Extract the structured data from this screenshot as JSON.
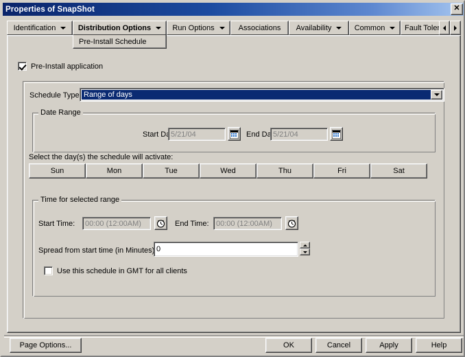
{
  "window": {
    "title": "Properties of SnapShot",
    "close_label": "✕"
  },
  "tabs": [
    {
      "label": "Identification",
      "has_arrow": true,
      "active": false
    },
    {
      "label": "Distribution Options",
      "has_arrow": true,
      "active": true
    },
    {
      "label": "Run Options",
      "has_arrow": true,
      "active": false
    },
    {
      "label": "Associations",
      "has_arrow": false,
      "active": false
    },
    {
      "label": "Availability",
      "has_arrow": true,
      "active": false
    },
    {
      "label": "Common",
      "has_arrow": true,
      "active": false
    },
    {
      "label": "Fault Toleran",
      "has_arrow": false,
      "active": false
    }
  ],
  "subtab": {
    "label": "Pre-Install Schedule"
  },
  "tab_scroll": {
    "left": "◄",
    "right": "►"
  },
  "form": {
    "pre_install_checkbox": {
      "label": "Pre-Install application",
      "checked": true
    },
    "schedule_type": {
      "label": "Schedule Type:",
      "value": "Range of days",
      "options": [
        "Range of days"
      ]
    },
    "date_range": {
      "title": "Date Range",
      "start_label": "Start Date",
      "start_value": "5/21/04",
      "end_label": "End Date",
      "end_value": "5/21/04",
      "start_picker_icon": "calendar-icon",
      "end_picker_icon": "calendar-icon"
    },
    "days": {
      "instruction": "Select the day(s) the schedule will activate:",
      "buttons": [
        "Sun",
        "Mon",
        "Tue",
        "Wed",
        "Thu",
        "Fri",
        "Sat"
      ]
    },
    "time_range": {
      "title": "Time for selected range",
      "start_label": "Start Time:",
      "start_value": "00:00 (12:00AM)",
      "end_label": "End Time:",
      "end_value": "00:00 (12:00AM)",
      "start_picker_icon": "clock-icon",
      "end_picker_icon": "clock-icon"
    },
    "spread": {
      "label": "Spread from start time (in Minutes)",
      "value": "0"
    },
    "gmt_checkbox": {
      "label": "Use this schedule in GMT for all clients",
      "checked": false
    }
  },
  "footer": {
    "page_options": "Page Options...",
    "ok": "OK",
    "cancel": "Cancel",
    "apply": "Apply",
    "help": "Help"
  },
  "colors": {
    "face": "#d4d0c8",
    "title_start": "#0a246a",
    "title_end": "#a6c6f0",
    "selection": "#0a2a72",
    "disabled_text": "#808080"
  }
}
